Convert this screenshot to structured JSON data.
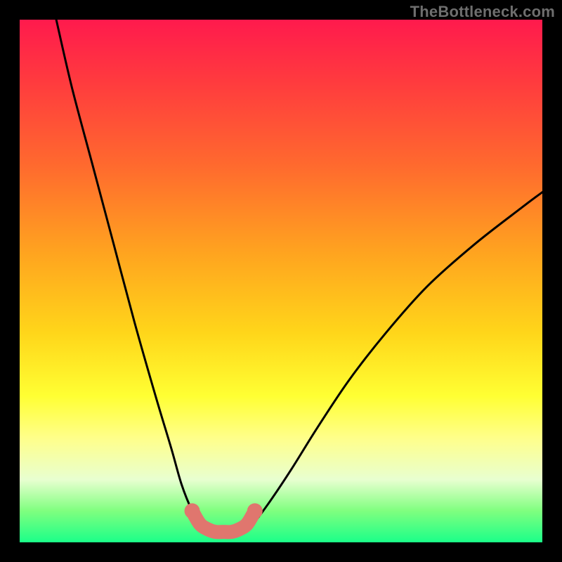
{
  "watermark": "TheBottleneck.com",
  "colors": {
    "frame": "#000000",
    "curve": "#000000",
    "marker_fill": "#e0766e",
    "marker_stroke": "#d86a62"
  },
  "chart_data": {
    "type": "line",
    "title": "",
    "xlabel": "",
    "ylabel": "",
    "xlim": [
      0,
      100
    ],
    "ylim": [
      0,
      100
    ],
    "grid": false,
    "legend": false,
    "annotations": [
      "TheBottleneck.com"
    ],
    "series": [
      {
        "name": "left-branch",
        "x": [
          7,
          10,
          14,
          18,
          22,
          26,
          29,
          31,
          33,
          34.5,
          36
        ],
        "y": [
          100,
          87,
          72,
          57,
          42,
          28,
          18,
          11,
          6,
          3.5,
          2.5
        ]
      },
      {
        "name": "right-branch",
        "x": [
          43,
          45,
          48,
          52,
          57,
          63,
          70,
          78,
          87,
          96,
          100
        ],
        "y": [
          2.5,
          4,
          8,
          14,
          22,
          31,
          40,
          49,
          57,
          64,
          67
        ]
      },
      {
        "name": "valley-markers",
        "x": [
          33,
          34.5,
          36,
          37.5,
          39,
          40.5,
          42,
          43.5,
          45
        ],
        "y": [
          6,
          3.5,
          2.5,
          2,
          2,
          2,
          2.5,
          3.5,
          6
        ]
      }
    ],
    "notes": "Values are read in percent of the plot area (0–100). The left curve descends steeply from the top-left; the right curve rises toward the upper-right. A thick salmon-colored marker band traces the valley floor."
  }
}
